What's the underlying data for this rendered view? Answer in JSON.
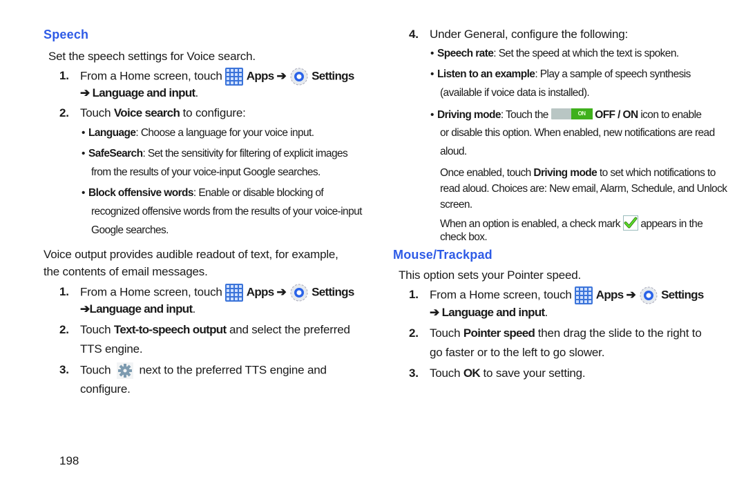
{
  "left": {
    "speech_heading": "Speech",
    "speech_intro": "Set the speech settings for Voice search.",
    "step1": {
      "num": "1.",
      "text_a": "From a Home screen, touch",
      "apps": "Apps ➔",
      "settings": "Settings",
      "path": "➔ Language and input",
      "end": "."
    },
    "step2": {
      "num": "2.",
      "text_a": "Touch ",
      "bold": "Voice search",
      "text_b": " to configure:"
    },
    "bullets": [
      {
        "bold": "Language",
        "text": ": Choose a language for your voice input."
      },
      {
        "bold": "SafeSearch",
        "text": ": Set the sensitivity for filtering of explicit images",
        "cont": "from the results of your voice-input Google searches."
      },
      {
        "bold": "Block offensive words",
        "text": ": Enable or disable blocking of",
        "cont": "recognized offensive words from the results of your voice-input",
        "cont2": "Google searches."
      }
    ],
    "voice_output_line1": "Voice output provides audible readout of text, for example,",
    "voice_output_line2": "the contents of email messages.",
    "vo_step1": {
      "num": "1.",
      "text_a": "From a Home screen, touch",
      "apps": "Apps ➔",
      "settings": "Settings",
      "path": "➔Language and input",
      "end": "."
    },
    "vo_step2": {
      "num": "2.",
      "text_a": "Touch ",
      "bold": "Text-to-speech output",
      "text_b": " and select the preferred",
      "cont": "TTS engine."
    },
    "vo_step3": {
      "num": "3.",
      "text_a": "Touch",
      "text_b": "next to the preferred TTS engine and",
      "cont": "configure."
    },
    "page_number": "198"
  },
  "right": {
    "step4": {
      "num": "4.",
      "text": "Under General, configure the following:"
    },
    "bullets": [
      {
        "bold": "Speech rate",
        "text": ": Set the speed at which the text is spoken."
      },
      {
        "bold": "Listen to an example",
        "text": ": Play a sample of speech synthesis",
        "cont": "(available if voice data is installed)."
      }
    ],
    "driving": {
      "bold": "Driving mode",
      "text_a": ": Touch the",
      "toggle_label": "ON",
      "bold2": "OFF / ON",
      "text_b": " icon to enable",
      "cont": "or disable this option. When enabled, new notifications are read",
      "cont2": "aloud."
    },
    "once_enabled": {
      "text_a": "Once enabled, touch ",
      "bold": "Driving mode",
      "text_b": " to set which notifications to",
      "line2": "read aloud. Choices are: New email, Alarm, Schedule, and Unlock",
      "line3": "screen."
    },
    "checkmark": {
      "text_a": "When an option is enabled, a check mark",
      "text_b": "appears in the",
      "line2": "check box."
    },
    "mouse_heading": "Mouse/Trackpad",
    "mouse_intro": "This option sets your Pointer speed.",
    "m_step1": {
      "num": "1.",
      "text_a": "From a Home screen, touch",
      "apps": "Apps ➔",
      "settings": "Settings",
      "path": "➔ Language and input",
      "end": "."
    },
    "m_step2": {
      "num": "2.",
      "text_a": "Touch ",
      "bold": "Pointer speed",
      "text_b": " then drag the slide to the right to",
      "cont": "go faster or to the left to go slower."
    },
    "m_step3": {
      "num": "3.",
      "text_a": "Touch ",
      "bold": "OK",
      "text_b": " to save your setting."
    }
  },
  "colors": {
    "heading": "#2e5be6",
    "apps_icon": "#3a73d9",
    "toggle_on": "#3fb01c",
    "check": "#4cd21a"
  }
}
